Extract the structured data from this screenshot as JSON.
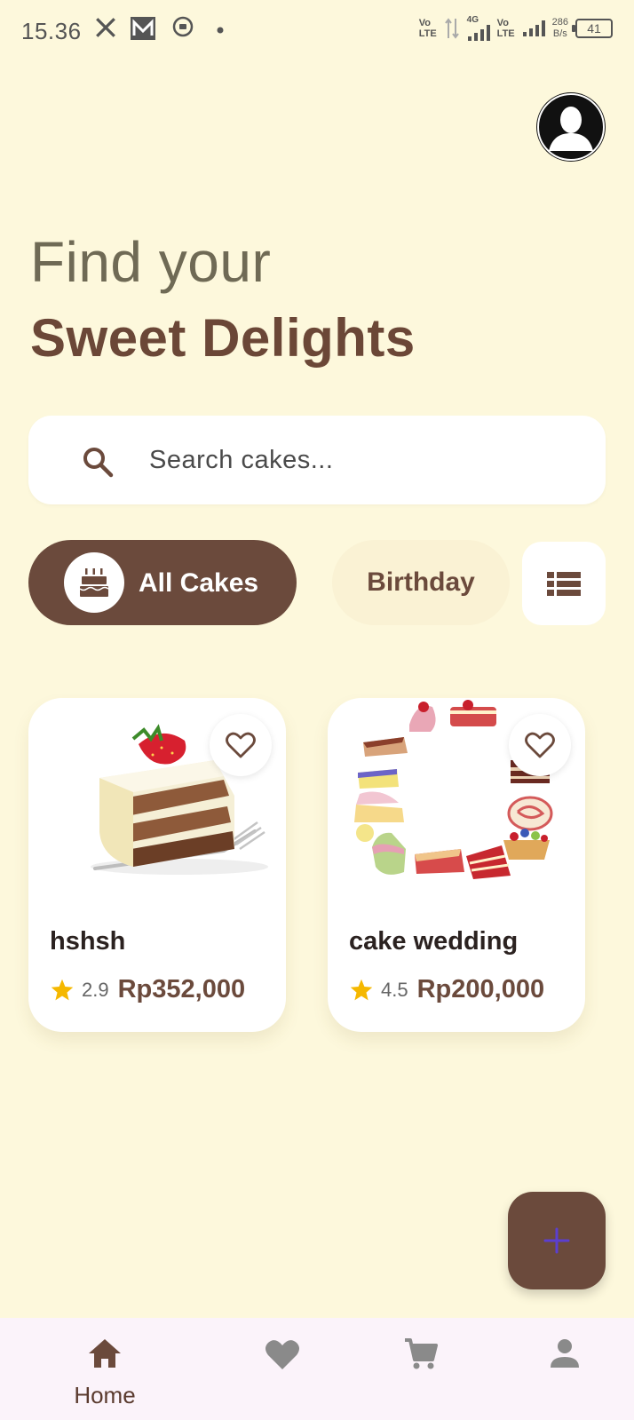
{
  "status_bar": {
    "time": "15.36",
    "lte1": "Vo",
    "lte1b": "LTE",
    "net_4g": "4G",
    "lte2": "Vo",
    "lte2b": "LTE",
    "speed_value": "286",
    "speed_unit": "B/s",
    "battery": "41"
  },
  "header": {
    "line1": "Find your",
    "line2": "Sweet Delights"
  },
  "search": {
    "placeholder": "Search cakes..."
  },
  "categories": [
    {
      "label": "All Cakes",
      "selected": true,
      "icon": "cake-icon"
    },
    {
      "label": "Birthday",
      "selected": false
    }
  ],
  "products": [
    {
      "name": "hshsh",
      "rating": "2.9",
      "price": "Rp352,000"
    },
    {
      "name": "cake wedding",
      "rating": "4.5",
      "price": "Rp200,000"
    }
  ],
  "bottom_nav": {
    "items": [
      {
        "label": "Home",
        "icon": "home-icon",
        "active": true
      },
      {
        "label": "",
        "icon": "heart-icon"
      },
      {
        "label": "",
        "icon": "cart-icon"
      },
      {
        "label": "",
        "icon": "person-icon"
      }
    ]
  },
  "colors": {
    "background": "#fdf8dc",
    "brand_brown": "#6b4a3c",
    "star": "#f5b800",
    "fab_plus": "#5b3fd0"
  }
}
